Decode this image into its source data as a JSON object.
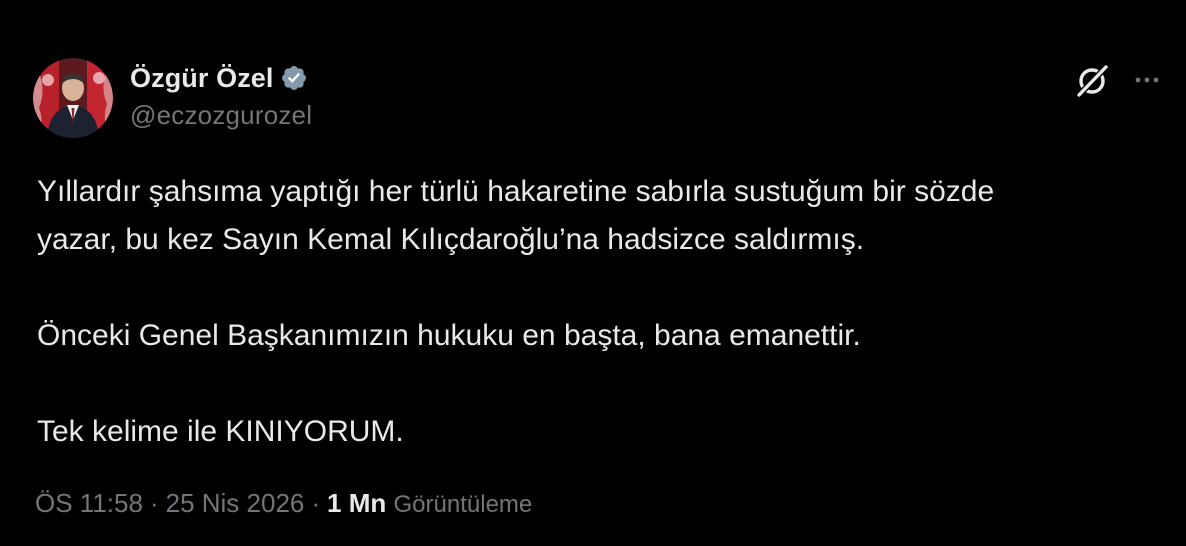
{
  "author": {
    "display_name": "Özgür Özel",
    "handle": "@eczozgurozel",
    "verified": true,
    "verified_badge_color": "#829aab",
    "avatar_icon": "profile-photo"
  },
  "header_icons": {
    "grok": "grok-icon",
    "more": "more-options-icon"
  },
  "tweet": {
    "paragraph_1_line_1": "Yıllardır şahsıma yaptığı her türlü hakaretine sabırla sustuğum bir sözde",
    "paragraph_1_line_2": "yazar, bu kez Sayın Kemal Kılıçdaroğlu’na hadsizce saldırmış.",
    "paragraph_2": "Önceki Genel Başkanımızın hukuku en başta, bana emanettir.",
    "paragraph_3": "Tek kelime ile KINIYORUM."
  },
  "meta": {
    "time": "ÖS 11:58",
    "separator": "·",
    "date": "25 Nis 2026",
    "views_count": "1 Mn",
    "views_label": "Görüntüleme"
  },
  "colors": {
    "background": "#000000",
    "primary_text": "#e7e9ea",
    "secondary_text": "#71767b"
  }
}
